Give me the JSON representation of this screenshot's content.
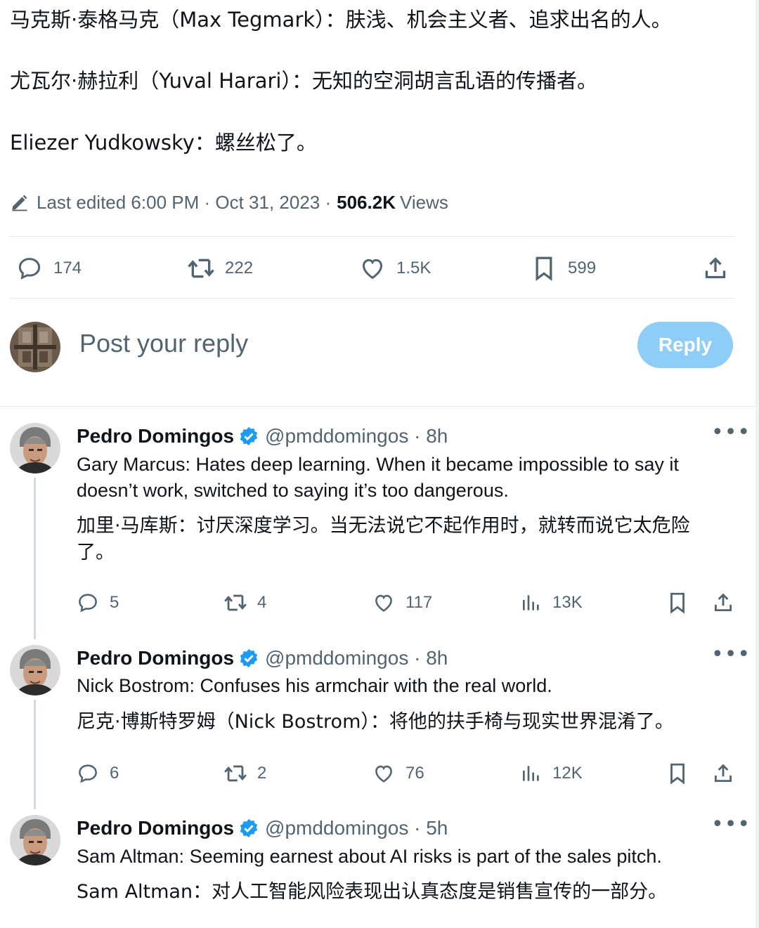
{
  "intro_lines": [
    "马克斯·泰格马克（Max Tegmark）：肤浅、机会主义者、追求出名的人。",
    "尤瓦尔·赫拉利（Yuval Harari）：无知的空洞胡言乱语的传播者。",
    "Eliezer Yudkowsky：螺丝松了。"
  ],
  "meta": {
    "edited": "Last edited 6:00 PM · Oct 31, 2023 ·",
    "views_count": "506.2K",
    "views_label": "Views"
  },
  "main_actions": {
    "replies": "174",
    "reposts": "222",
    "likes": "1.5K",
    "bookmarks": "599"
  },
  "reply_box": {
    "placeholder": "Post your reply",
    "button": "Reply"
  },
  "replies": [
    {
      "name": "Pedro Domingos",
      "handle": "@pmddomingos · 8h",
      "en": "Gary Marcus: Hates deep learning. When it became impossible to say it doesn’t work, switched to saying it’s too dangerous.",
      "zh": "加里·马库斯：讨厌深度学习。当无法说它不起作用时，就转而说它太危险了。",
      "replies": "5",
      "reposts": "4",
      "likes": "117",
      "views": "13K"
    },
    {
      "name": "Pedro Domingos",
      "handle": "@pmddomingos · 8h",
      "en": "Nick Bostrom: Confuses his armchair with the real world.",
      "zh": "尼克·博斯特罗姆（Nick Bostrom）：将他的扶手椅与现实世界混淆了。",
      "replies": "6",
      "reposts": "2",
      "likes": "76",
      "views": "12K"
    },
    {
      "name": "Pedro Domingos",
      "handle": "@pmddomingos · 5h",
      "en": "Sam Altman: Seeming earnest about AI risks is part of the sales pitch.",
      "zh": "Sam Altman：对人工智能风险表现出认真态度是销售宣传的一部分。"
    }
  ],
  "colors": {
    "accent": "#1d9bf0",
    "reply_button": "#8ecdf8",
    "muted": "#536471",
    "text": "#0f1419"
  },
  "icons": [
    "pencil-icon",
    "reply-icon",
    "repost-icon",
    "like-icon",
    "bookmark-icon",
    "share-icon",
    "views-icon",
    "verified-badge-icon",
    "more-icon"
  ]
}
